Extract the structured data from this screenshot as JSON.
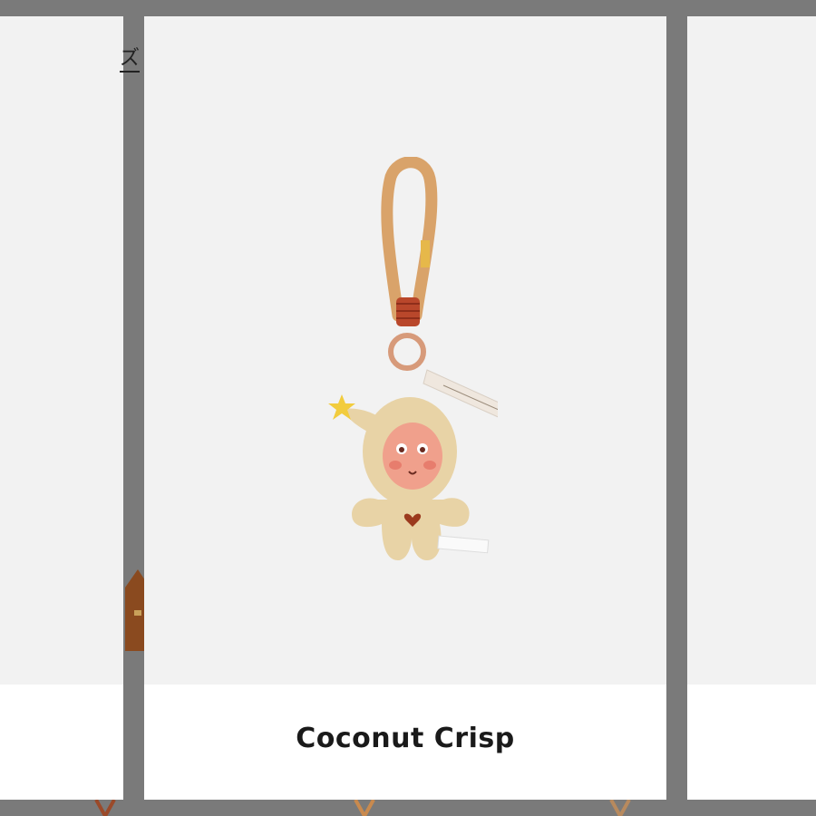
{
  "carousel": {
    "left_card": {
      "title_fragment": "ズ"
    },
    "center_card": {
      "product_name": "Coconut Crisp",
      "image_description": "keychain-plush-image"
    },
    "right_card": {}
  },
  "colors": {
    "background": "#7a7a7a",
    "card_bg": "#f2f2f2",
    "caption_bg": "#ffffff",
    "text": "#1a1a1a",
    "plush": "#e8d3a6",
    "strap": "#d9a36a",
    "star": "#f2cc3d"
  }
}
